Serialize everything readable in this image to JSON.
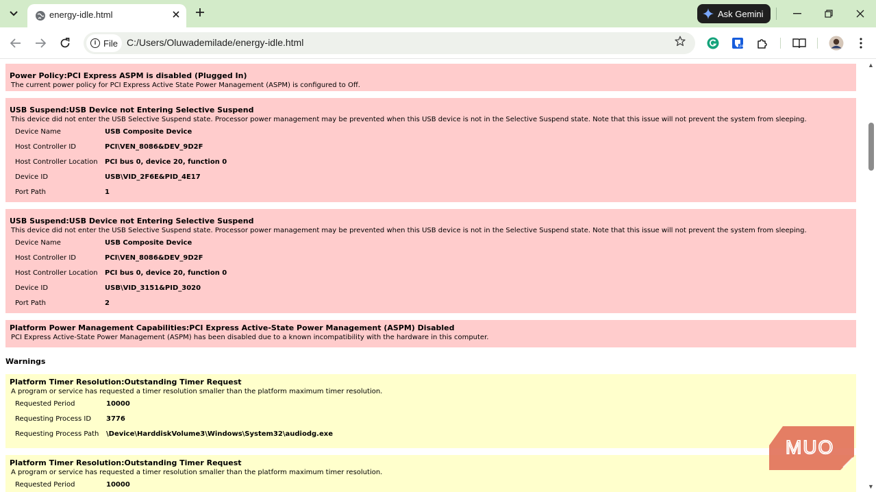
{
  "browser": {
    "tab_title": "energy-idle.html",
    "new_tab": "+",
    "ask_gemini": "Ask Gemini",
    "site_chip": "File",
    "url": "C:/Users/Oluwademilade/energy-idle.html",
    "icons": [
      "tab-search-icon",
      "globe-icon",
      "close-icon",
      "plus-icon",
      "gemini-star-icon",
      "minimize-icon",
      "restore-icon",
      "window-close-icon",
      "back-icon",
      "forward-icon",
      "reload-icon",
      "info-icon",
      "bookmark-star-icon",
      "grammarly-icon",
      "bitwarden-icon",
      "extensions-icon",
      "reading-list-icon",
      "profile-avatar-icon",
      "more-menu-icon"
    ]
  },
  "report": {
    "errors": [
      {
        "title": "Power Policy:PCI Express ASPM is disabled (Plugged In)",
        "desc": "The current power policy for PCI Express Active State Power Management (ASPM) is configured to Off.",
        "rows": []
      },
      {
        "title": "USB Suspend:USB Device not Entering Selective Suspend",
        "desc": "This device did not enter the USB Selective Suspend state. Processor power management may be prevented when this USB device is not in the Selective Suspend state. Note that this issue will not prevent the system from sleeping.",
        "rows": [
          {
            "label": "Device Name",
            "value": "USB Composite Device"
          },
          {
            "label": "Host Controller ID",
            "value": "PCI\\VEN_8086&DEV_9D2F"
          },
          {
            "label": "Host Controller Location",
            "value": "PCI bus 0, device 20, function 0"
          },
          {
            "label": "Device ID",
            "value": "USB\\VID_2F6E&PID_4E17"
          },
          {
            "label": "Port Path",
            "value": "1"
          }
        ]
      },
      {
        "title": "USB Suspend:USB Device not Entering Selective Suspend",
        "desc": "This device did not enter the USB Selective Suspend state. Processor power management may be prevented when this USB device is not in the Selective Suspend state. Note that this issue will not prevent the system from sleeping.",
        "rows": [
          {
            "label": "Device Name",
            "value": "USB Composite Device"
          },
          {
            "label": "Host Controller ID",
            "value": "PCI\\VEN_8086&DEV_9D2F"
          },
          {
            "label": "Host Controller Location",
            "value": "PCI bus 0, device 20, function 0"
          },
          {
            "label": "Device ID",
            "value": "USB\\VID_3151&PID_3020"
          },
          {
            "label": "Port Path",
            "value": "2"
          }
        ]
      },
      {
        "title": "Platform Power Management Capabilities:PCI Express Active-State Power Management (ASPM) Disabled",
        "desc": "PCI Express Active-State Power Management (ASPM) has been disabled due to a known incompatibility with the hardware in this computer.",
        "rows": []
      }
    ],
    "warnings_heading": "Warnings",
    "warnings": [
      {
        "title": "Platform Timer Resolution:Outstanding Timer Request",
        "desc": "A program or service has requested a timer resolution smaller than the platform maximum timer resolution.",
        "rows": [
          {
            "label": "Requested Period",
            "value": "10000"
          },
          {
            "label": "Requesting Process ID",
            "value": "3776"
          },
          {
            "label": "Requesting Process Path",
            "value": "\\Device\\HarddiskVolume3\\Windows\\System32\\audiodg.exe"
          }
        ]
      },
      {
        "title": "Platform Timer Resolution:Outstanding Timer Request",
        "desc": "A program or service has requested a timer resolution smaller than the platform maximum timer resolution.",
        "rows": [
          {
            "label": "Requested Period",
            "value": "10000"
          }
        ]
      }
    ]
  },
  "watermark": "MUO",
  "colors": {
    "error_bg": "#ffcccc",
    "warning_bg": "#ffffcc",
    "tabstrip_bg": "#d3ebc9",
    "watermark": "#e2735b"
  }
}
